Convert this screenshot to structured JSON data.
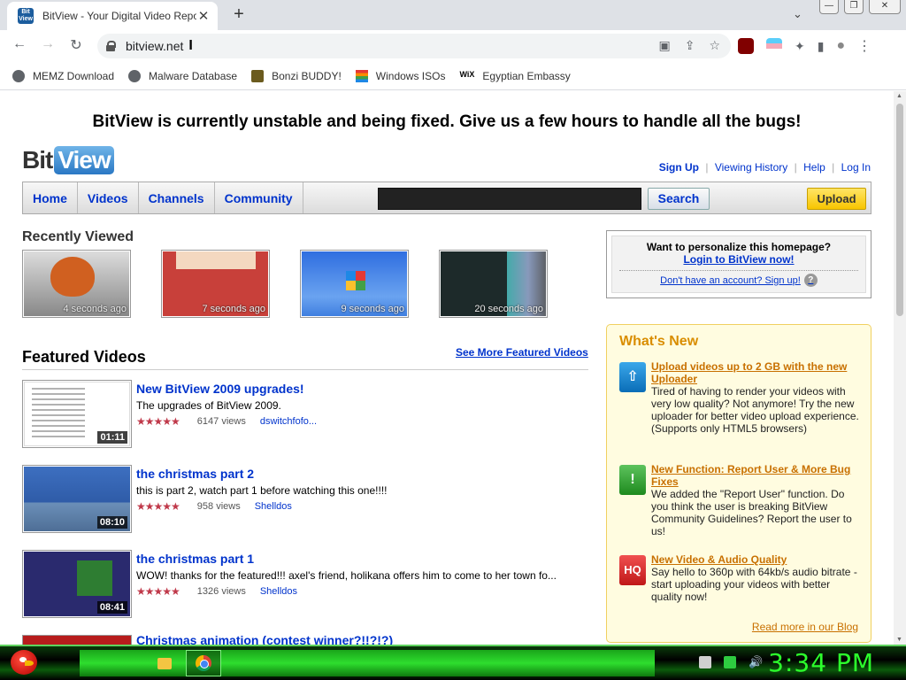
{
  "browser": {
    "tab_title": "BitView - Your Digital Video Repo",
    "favicon_text": [
      "Bit",
      "View"
    ],
    "url": "bitview.net",
    "bookmarks": [
      {
        "label": "MEMZ Download"
      },
      {
        "label": "Malware Database"
      },
      {
        "label": "Bonzi BUDDY!"
      },
      {
        "label": "Windows ISOs"
      },
      {
        "label": "Egyptian Embassy"
      }
    ],
    "icons": {
      "back": "←",
      "forward": "→",
      "reload": "↻",
      "new_tab": "+",
      "close_tab": "✕",
      "tab_search": "⌄",
      "cast": "▣",
      "share": "⇪",
      "star": "☆",
      "puzzle": "✦",
      "sidebar": "▮",
      "profile": "●",
      "menu": "⋮",
      "minimize": "—",
      "maximize": "❐",
      "close": "✕",
      "ibeam": "I",
      "wix": "WiX"
    }
  },
  "site": {
    "banner": "BitView is currently unstable and being fixed. Give us a few hours to handle all the bugs!",
    "logo_bit": "Bit",
    "logo_view": "View",
    "toplinks": {
      "signup": "Sign Up",
      "history": "Viewing History",
      "help": "Help",
      "login": "Log In",
      "sep": "|"
    },
    "nav": {
      "home": "Home",
      "videos": "Videos",
      "channels": "Channels",
      "community": "Community",
      "search": "Search",
      "upload": "Upload"
    },
    "recently_viewed": {
      "title": "Recently Viewed",
      "items": [
        {
          "time": "4 seconds ago"
        },
        {
          "time": "7 seconds ago"
        },
        {
          "time": "9 seconds ago"
        },
        {
          "time": "20 seconds ago"
        }
      ]
    },
    "featured": {
      "title": "Featured Videos",
      "see_more": "See More Featured Videos",
      "videos": [
        {
          "title": "New BitView 2009 upgrades!",
          "description": "The upgrades of BitView 2009.",
          "views": "6147 views",
          "author": "dswitchfofo...",
          "duration": "01:11",
          "rating": 4.5
        },
        {
          "title": "the christmas part 2",
          "description": "this is part 2, watch part 1 before watching this one!!!!",
          "views": "958 views",
          "author": "Shelldos",
          "duration": "08:10",
          "rating": 4.5
        },
        {
          "title": "the christmas part 1",
          "description": "WOW! thanks for the featured!!! axel's friend, holikana offers him to come to her town fo...",
          "views": "1326 views",
          "author": "Shelldos",
          "duration": "08:41",
          "rating": 4.5
        },
        {
          "title": "Christmas animation (contest winner?!!?!?)"
        }
      ],
      "stars": "★★★★★"
    },
    "personalize": {
      "question": "Want to personalize this homepage?",
      "login": "Login to BitView now!",
      "signup": "Don't have an account? Sign up!",
      "help_icon": "?"
    },
    "whats_new": {
      "title": "What's New",
      "items": [
        {
          "icon": "⇧",
          "headline": "Upload videos up to 2 GB with the new Uploader",
          "body": "Tired of having to render your videos with very low quality? Not anymore! Try the new uploader for better video upload experience. (Supports only HTML5 browsers)"
        },
        {
          "icon": "!",
          "headline": "New Function: Report User & More Bug Fixes",
          "body": "We added the \"Report User\" function. Do you think the user is breaking BitView Community Guidelines? Report the user to us!"
        },
        {
          "icon": "HQ",
          "headline": "New Video & Audio Quality",
          "body": "Say hello to 360p with 64kb/s audio bitrate - start uploading your videos with better quality now!"
        }
      ],
      "read_more": "Read more in our Blog"
    }
  },
  "taskbar": {
    "clock": "3:34 PM",
    "tray": {
      "volume": "🔊"
    }
  }
}
